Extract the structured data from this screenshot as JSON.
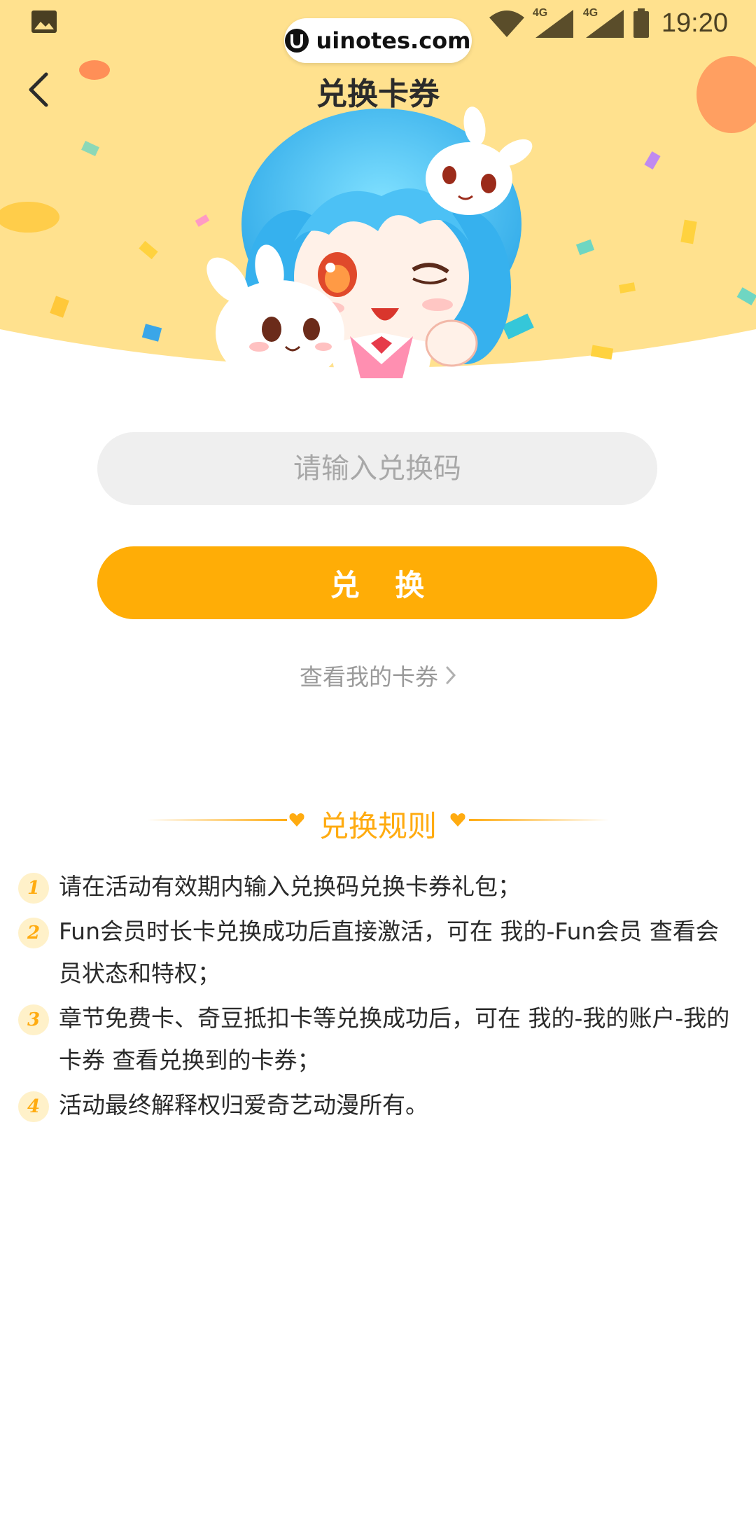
{
  "status_bar": {
    "network_1": "4G",
    "network_2": "4G",
    "time": "19:20"
  },
  "watermark": {
    "logo_letter": "U",
    "text": "uinotes.com"
  },
  "header": {
    "title": "兑换卡券",
    "background_color": "#ffe18e"
  },
  "form": {
    "code_placeholder": "请输入兑换码",
    "code_value": "",
    "redeem_label": "兑 换",
    "view_coupons_label": "查看我的卡券"
  },
  "rules": {
    "title": "兑换规则",
    "items": [
      {
        "num": "1",
        "text": "请在活动有效期内输入兑换码兑换卡券礼包；"
      },
      {
        "num": "2",
        "text": "Fun会员时长卡兑换成功后直接激活，可在 我的-Fun会员 查看会员状态和特权；"
      },
      {
        "num": "3",
        "text": "章节免费卡、奇豆抵扣卡等兑换成功后，可在 我的-我的账户-我的卡券 查看兑换到的卡券；"
      },
      {
        "num": "4",
        "text": "活动最终解释权归爱奇艺动漫所有。"
      }
    ]
  },
  "colors": {
    "accent": "#ffad06",
    "rule_accent": "#ffab10",
    "input_bg": "#efefef"
  }
}
